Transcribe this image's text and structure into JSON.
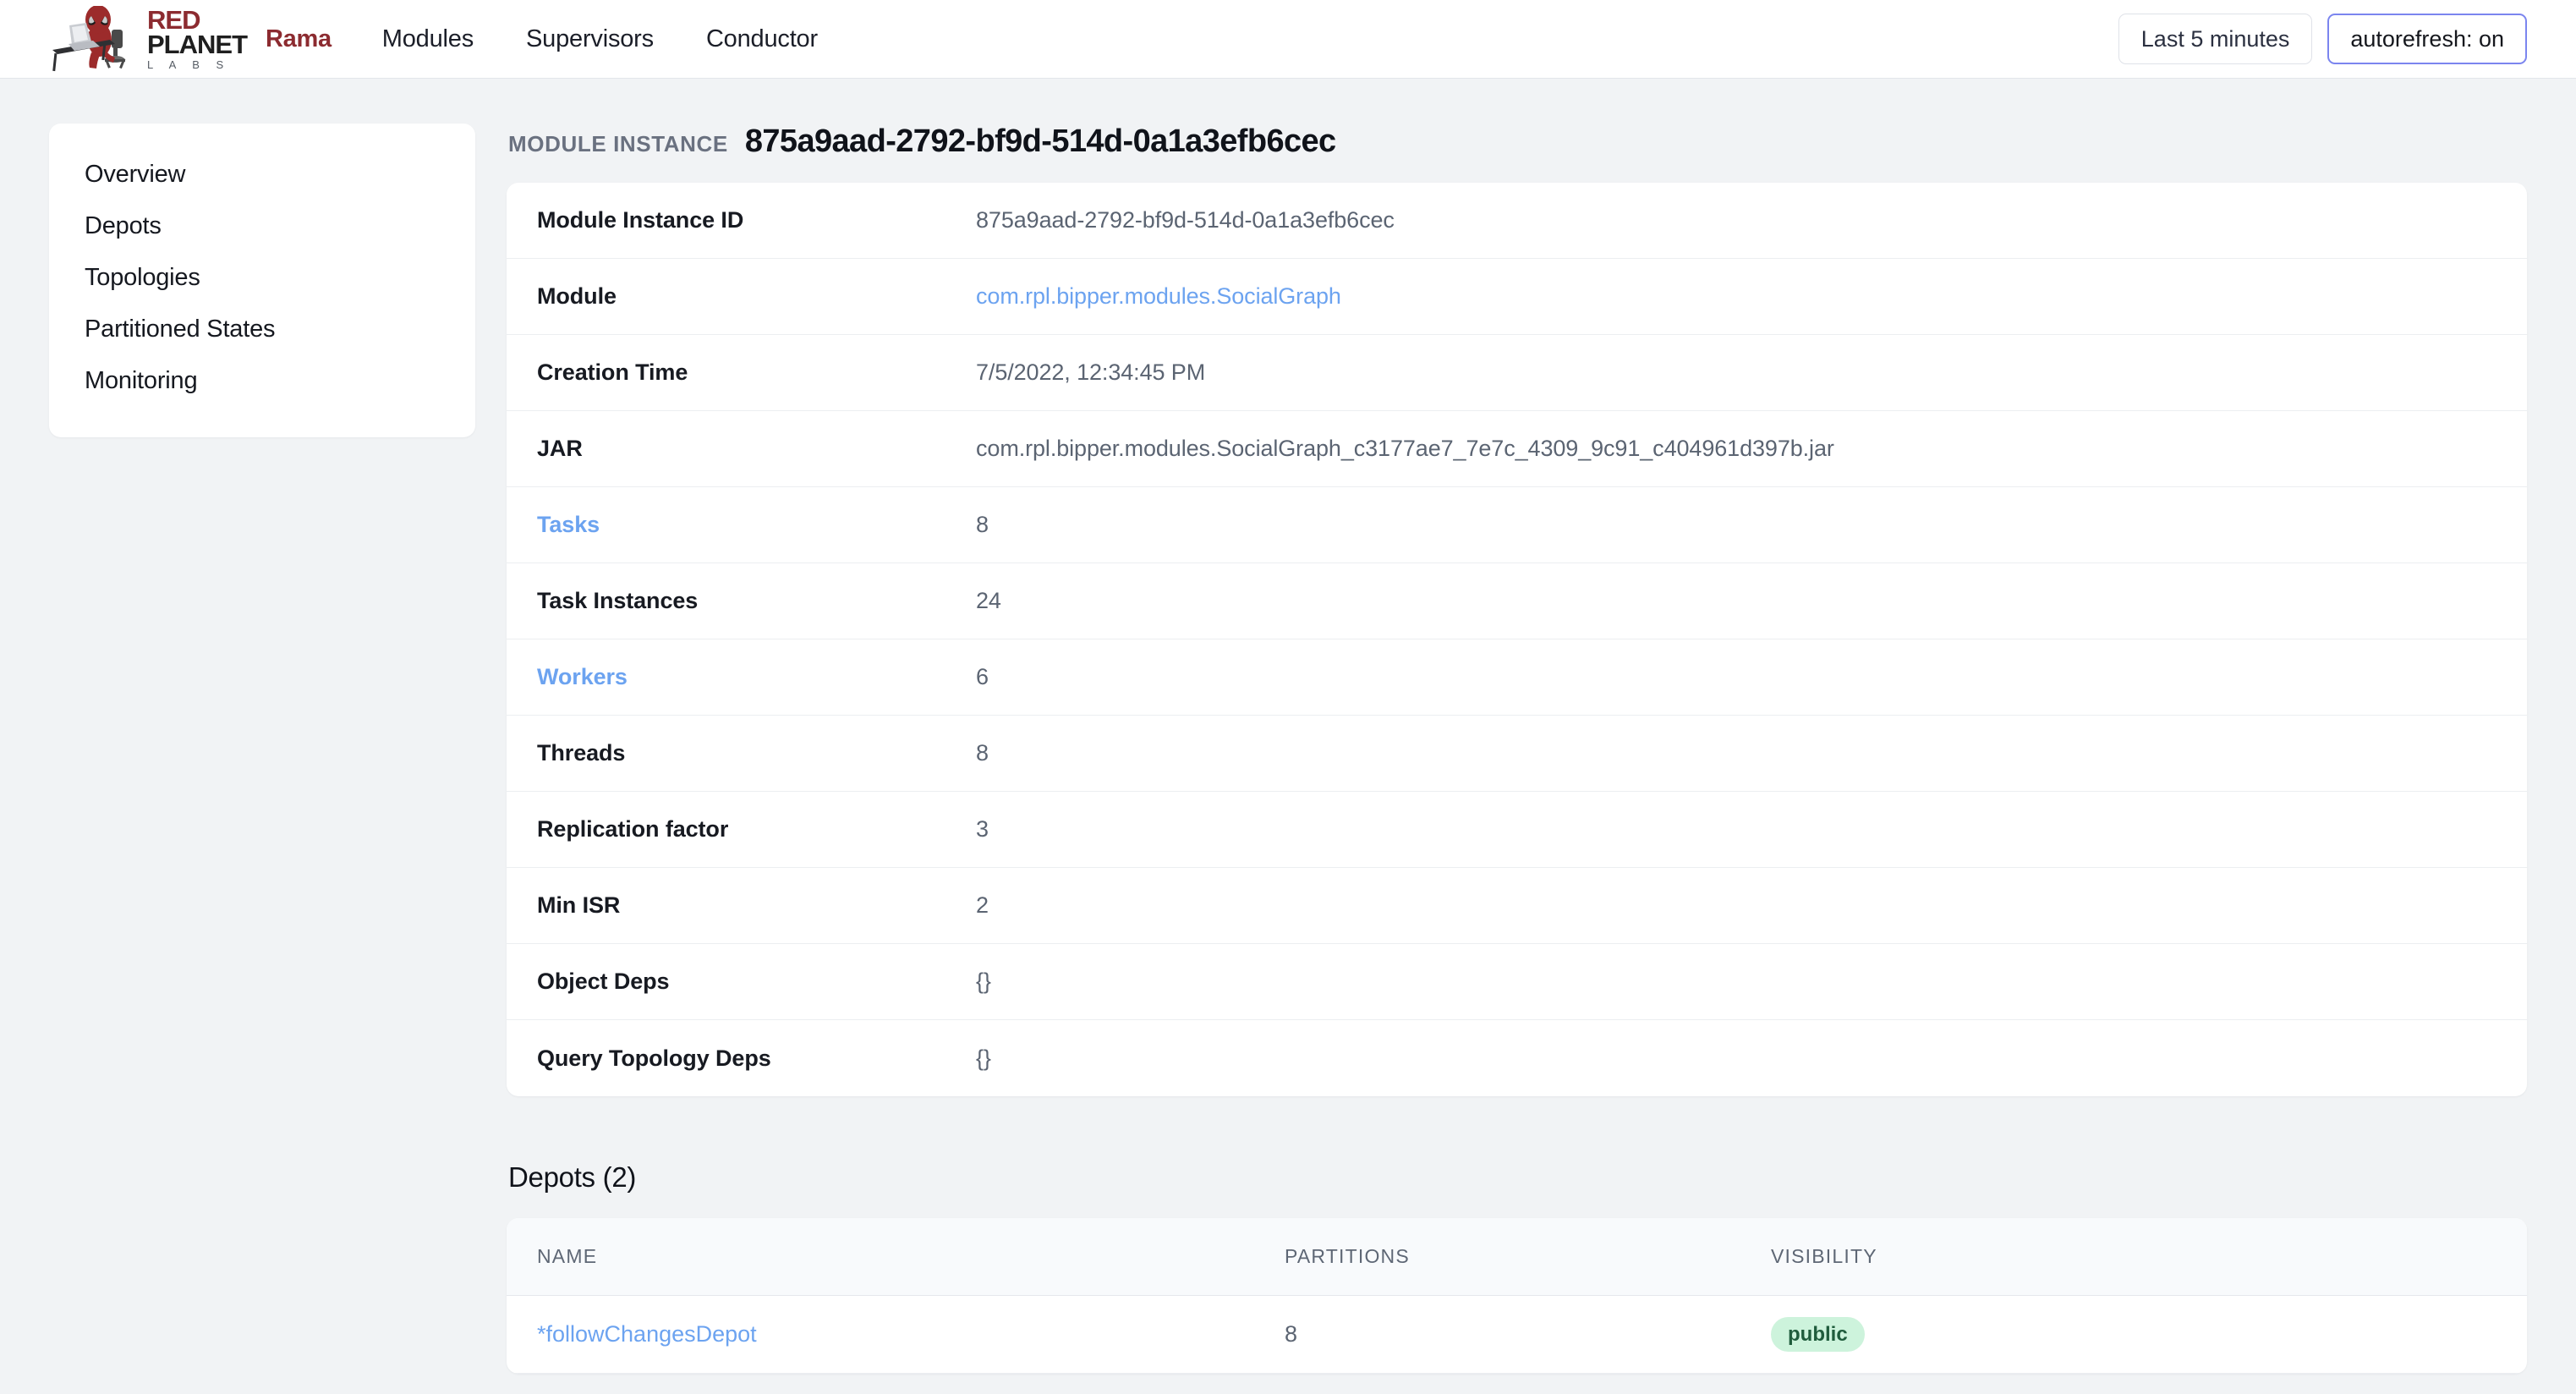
{
  "header": {
    "logo": {
      "icon": "alien-at-laptop-logo",
      "line1": "RED",
      "line2": "PLANET",
      "line3": "L A B S"
    },
    "brand_name": "Rama",
    "nav": [
      {
        "label": "Modules"
      },
      {
        "label": "Supervisors"
      },
      {
        "label": "Conductor"
      }
    ],
    "time_range_button": "Last 5 minutes",
    "autorefresh_button": "autorefresh: on",
    "accent_focus_color": "#7b85ef",
    "brand_color": "#8c2b30"
  },
  "sidebar": {
    "items": [
      {
        "label": "Overview"
      },
      {
        "label": "Depots"
      },
      {
        "label": "Topologies"
      },
      {
        "label": "Partitioned States"
      },
      {
        "label": "Monitoring"
      }
    ]
  },
  "page": {
    "eyebrow": "MODULE INSTANCE",
    "title": "875a9aad-2792-bf9d-514d-0a1a3efb6cec"
  },
  "details": {
    "rows": [
      {
        "key": "Module Instance ID",
        "key_link": false,
        "value": "875a9aad-2792-bf9d-514d-0a1a3efb6cec",
        "value_link": false
      },
      {
        "key": "Module",
        "key_link": false,
        "value": "com.rpl.bipper.modules.SocialGraph",
        "value_link": true
      },
      {
        "key": "Creation Time",
        "key_link": false,
        "value": "7/5/2022, 12:34:45 PM",
        "value_link": false
      },
      {
        "key": "JAR",
        "key_link": false,
        "value": "com.rpl.bipper.modules.SocialGraph_c3177ae7_7e7c_4309_9c91_c404961d397b.jar",
        "value_link": false
      },
      {
        "key": "Tasks",
        "key_link": true,
        "value": "8",
        "value_link": false
      },
      {
        "key": "Task Instances",
        "key_link": false,
        "value": "24",
        "value_link": false
      },
      {
        "key": "Workers",
        "key_link": true,
        "value": "6",
        "value_link": false
      },
      {
        "key": "Threads",
        "key_link": false,
        "value": "8",
        "value_link": false
      },
      {
        "key": "Replication factor",
        "key_link": false,
        "value": "3",
        "value_link": false
      },
      {
        "key": "Min ISR",
        "key_link": false,
        "value": "2",
        "value_link": false
      },
      {
        "key": "Object Deps",
        "key_link": false,
        "value": "{}",
        "value_link": false
      },
      {
        "key": "Query Topology Deps",
        "key_link": false,
        "value": "{}",
        "value_link": false
      }
    ]
  },
  "depots": {
    "title": "Depots (2)",
    "columns": [
      "NAME",
      "PARTITIONS",
      "VISIBILITY"
    ],
    "rows": [
      {
        "name": "*followChangesDepot",
        "partitions": "8",
        "visibility": "public",
        "visibility_color": "#cdf3dc"
      }
    ]
  }
}
